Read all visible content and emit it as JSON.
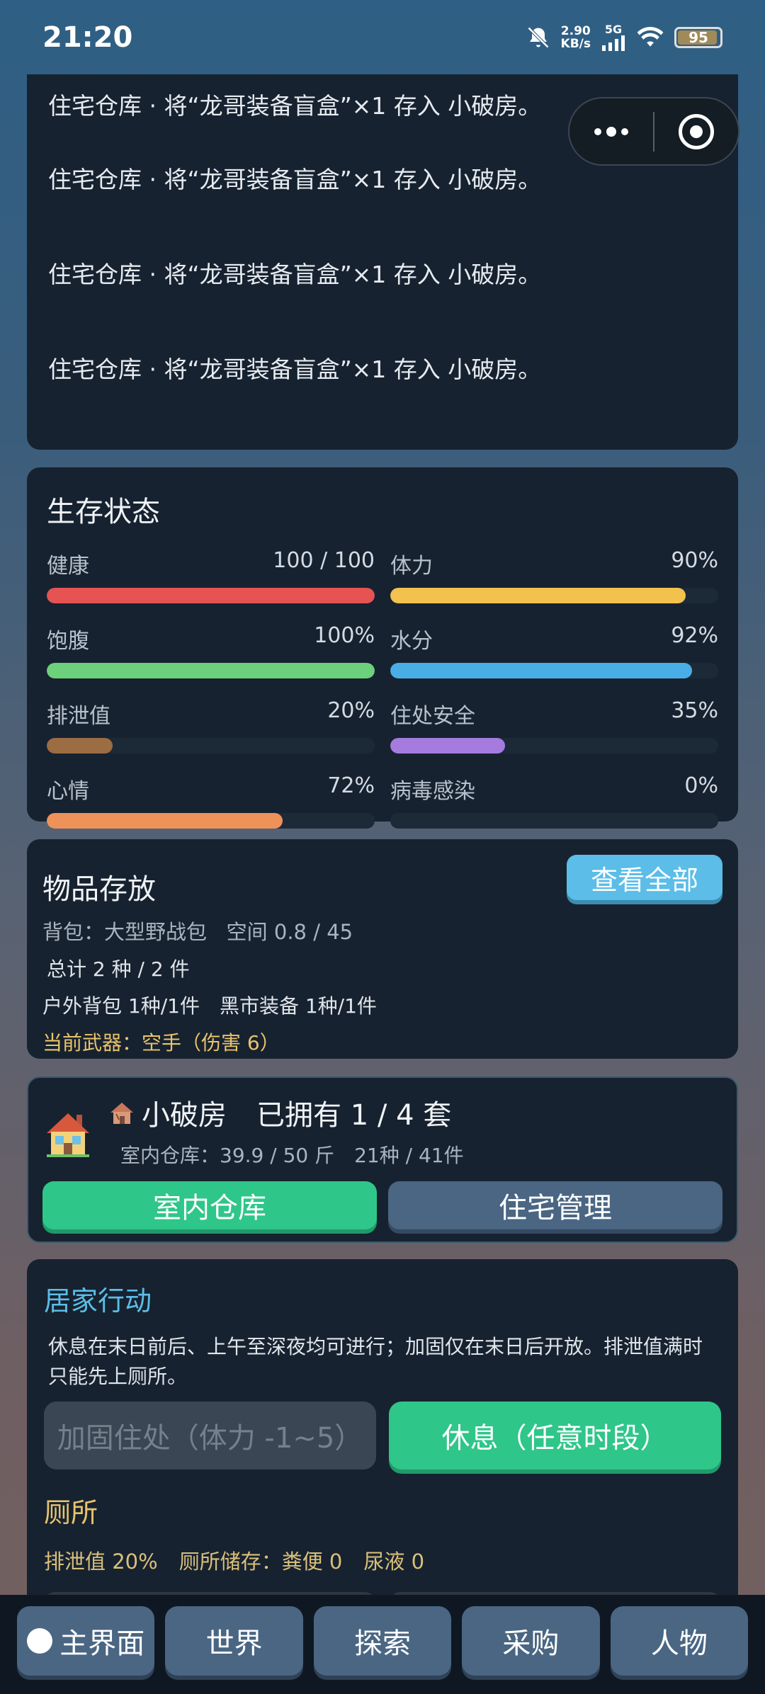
{
  "status_bar": {
    "time": "21:20",
    "net_speed_value": "2.90",
    "net_speed_unit": "KB/s",
    "network_type": "5G",
    "battery": "95",
    "battery_level": 0.95
  },
  "log": {
    "lines": [
      "住宅仓库 · 将“龙哥装备盲盒”×1 存入 小破房。",
      "住宅仓库 · 将“龙哥装备盲盒”×1 存入 小破房。",
      "住宅仓库 · 将“龙哥装备盲盒”×1 存入 小破房。",
      "住宅仓库 · 将“龙哥装备盲盒”×1 存入 小破房。"
    ]
  },
  "survival": {
    "title": "生存状态",
    "stats": [
      {
        "name": "健康",
        "value": "100 / 100",
        "level": 1.0,
        "color": "#e55353"
      },
      {
        "name": "体力",
        "value": "90%",
        "level": 0.9,
        "color": "#f2c14e"
      },
      {
        "name": "饱腹",
        "value": "100%",
        "level": 1.0,
        "color": "#6dd07a"
      },
      {
        "name": "水分",
        "value": "92%",
        "level": 0.92,
        "color": "#4aaee6"
      },
      {
        "name": "排泄值",
        "value": "20%",
        "level": 0.2,
        "color": "#9c6c43"
      },
      {
        "name": "住处安全",
        "value": "35%",
        "level": 0.35,
        "color": "#a67be0"
      },
      {
        "name": "心情",
        "value": "72%",
        "level": 0.72,
        "color": "#ee925a"
      },
      {
        "name": "病毒感染",
        "value": "0%",
        "level": 0.0,
        "color": "#8bd24a"
      }
    ]
  },
  "storage": {
    "title": "物品存放",
    "view_all": "查看全部",
    "backpack": "背包：大型野战包",
    "space": "空间 0.8 / 45",
    "total": "总计 2 种 / 2 件",
    "categories": "户外背包 1种/1件　黑市装备 1种/1件",
    "weapon": "当前武器：空手（伤害 6）"
  },
  "house": {
    "name": "小破房",
    "owned": "已拥有 1 / 4 套",
    "warehouse_info": "室内仓库：39.9 / 50 斤",
    "items_info": "21种 / 41件",
    "btn_warehouse": "室内仓库",
    "btn_manage": "住宅管理"
  },
  "actions": {
    "title": "居家行动",
    "desc": "休息在末日前后、上午至深夜均可进行；加固仅在末日后开放。排泄值满时只能先上厕所。",
    "btn_fortify": "加固住处（体力 -1~5）",
    "btn_rest": "休息（任意时段）",
    "toilet_title": "厕所",
    "toilet_excretion": "排泄值 20%",
    "toilet_storage": "厕所储存：粪便 0",
    "toilet_urine": "尿液 0"
  },
  "nav": {
    "home": "主界面",
    "world": "世界",
    "explore": "探索",
    "shop": "采购",
    "character": "人物"
  }
}
